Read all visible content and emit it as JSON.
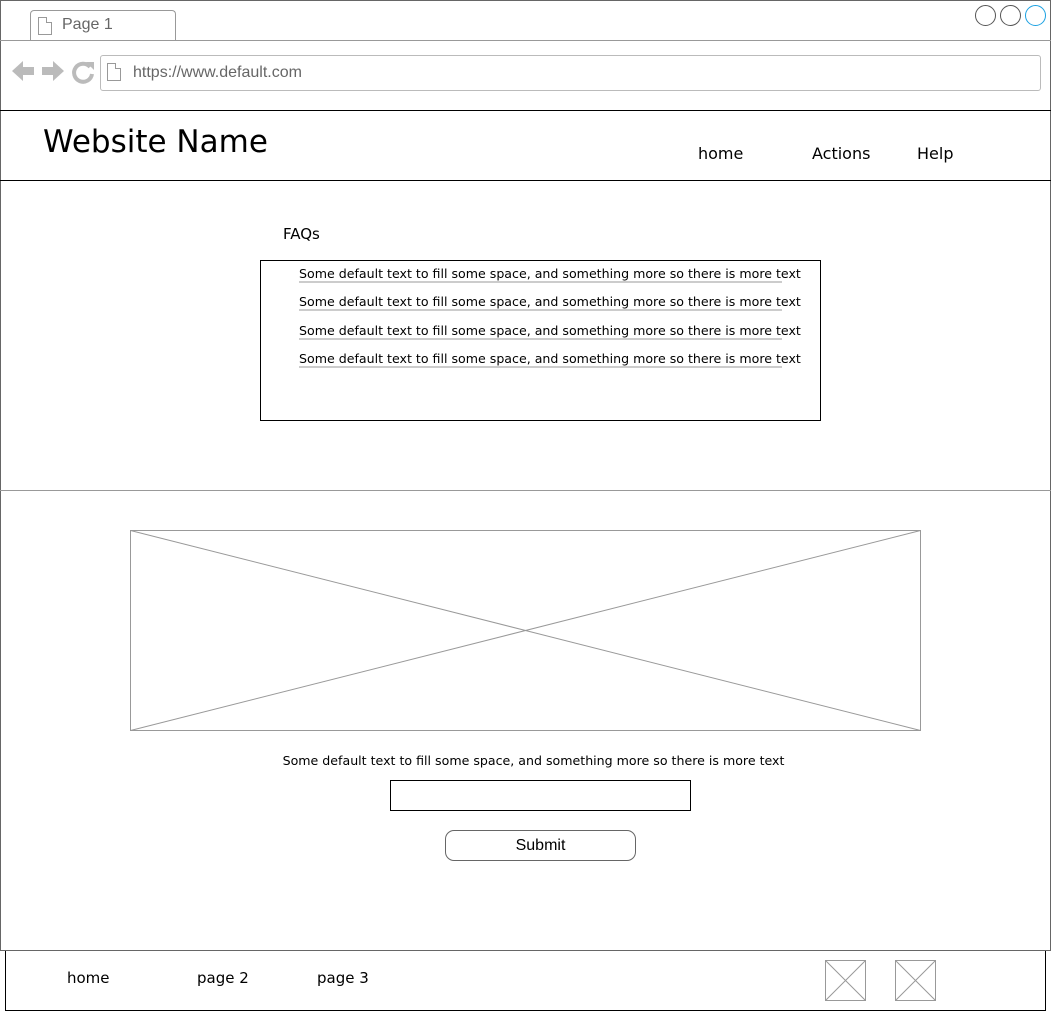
{
  "browser": {
    "tab_label": "Page 1",
    "url": "https://www.default.com",
    "accent_color": "#1ba1e2"
  },
  "header": {
    "site_name": "Website Name",
    "nav": [
      "home",
      "Actions",
      "Help"
    ]
  },
  "faq": {
    "title": "FAQs",
    "items": [
      "Some default text to fill some space, and something more so there is more text",
      "Some default text to fill some space, and something more so there is more text",
      "Some default text to fill some space, and something more so there is more text",
      "Some default text to fill some space, and something more so there is more text"
    ]
  },
  "main": {
    "body_text": "Some default text to fill some space, and something more so there is more text",
    "input_value": "",
    "submit_label": "Submit"
  },
  "footer": {
    "links": [
      "home",
      "page 2",
      "page 3"
    ]
  }
}
